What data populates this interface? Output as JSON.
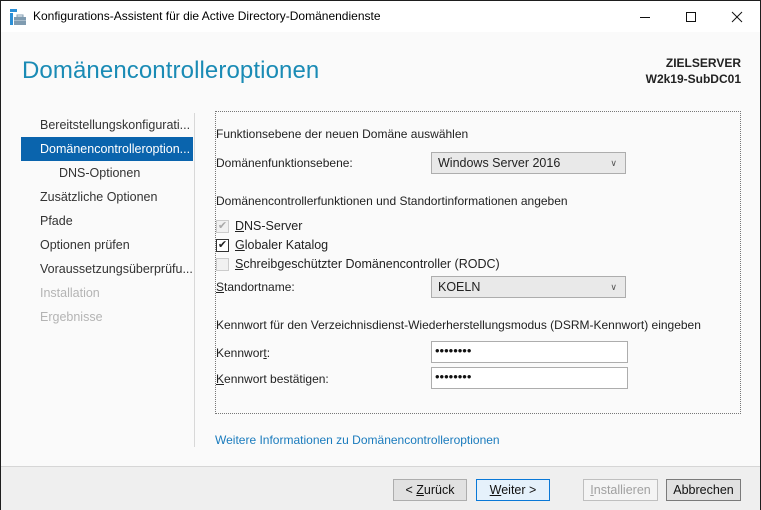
{
  "window": {
    "title": "Konfigurations-Assistent für die Active Directory-Domänendienste",
    "controls": {
      "minimize": "minimize-icon",
      "maximize": "maximize-icon",
      "close": "close-icon"
    }
  },
  "header": {
    "title": "Domänencontrolleroptionen",
    "target_label": "ZIELSERVER",
    "target_server": "W2k19-SubDC01"
  },
  "nav": {
    "items": [
      {
        "label": "Bereitstellungskonfigurati...",
        "state": "normal"
      },
      {
        "label": "Domänencontrolleroption...",
        "state": "active"
      },
      {
        "label": "DNS-Optionen",
        "state": "sub"
      },
      {
        "label": "Zusätzliche Optionen",
        "state": "normal"
      },
      {
        "label": "Pfade",
        "state": "normal"
      },
      {
        "label": "Optionen prüfen",
        "state": "normal"
      },
      {
        "label": "Voraussetzungsüberprüfu...",
        "state": "normal"
      },
      {
        "label": "Installation",
        "state": "disabled"
      },
      {
        "label": "Ergebnisse",
        "state": "disabled"
      }
    ]
  },
  "main": {
    "section1_heading": "Funktionsebene der neuen Domäne auswählen",
    "domain_level_label": "Domänenfunktionsebene:",
    "domain_level_value": "Windows Server 2016",
    "section2_heading": "Domänencontrollerfunktionen und Standortinformationen angeben",
    "checkboxes": [
      {
        "label_key": "D",
        "label_rest": "NS-Server",
        "checked": true,
        "enabled": false
      },
      {
        "label_key": "G",
        "label_rest": "lobaler Katalog",
        "checked": true,
        "enabled": true
      },
      {
        "label_key": "S",
        "label_rest": "chreibgeschützter Domänencontroller (RODC)",
        "checked": false,
        "enabled": false
      }
    ],
    "site_label_key": "S",
    "site_label_rest": "tandortname:",
    "site_value": "KOELN",
    "section3_heading": "Kennwort für den Verzeichnisdienst-Wiederherstellungsmodus (DSRM-Kennwort) eingeben",
    "password_label_pre": "Kennwor",
    "password_label_key": "t",
    "password_label_post": ":",
    "password_value": "••••••••",
    "confirm_label_key": "K",
    "confirm_label_rest": "ennwort bestätigen:",
    "confirm_value": "••••••••",
    "more_info_link": "Weitere Informationen zu Domänencontrolleroptionen"
  },
  "footer": {
    "back_pre": "< ",
    "back_key": "Z",
    "back_rest": "urück",
    "next_key": "W",
    "next_rest": "eiter >",
    "install_key": "I",
    "install_rest": "nstallieren",
    "cancel": "Abbrechen"
  },
  "colors": {
    "accent": "#0a64ad",
    "header_title": "#1a8bb5",
    "link": "#1a7bbd"
  }
}
